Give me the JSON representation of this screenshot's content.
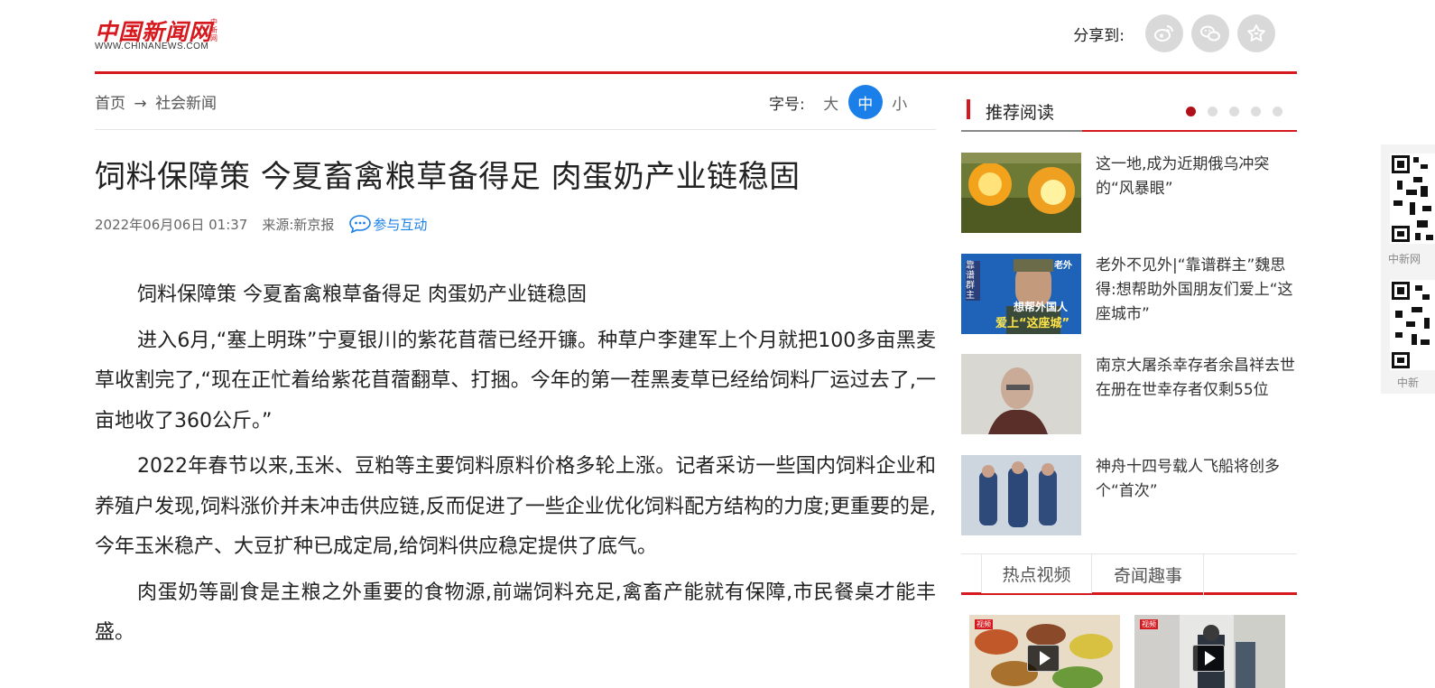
{
  "header": {
    "logo_cn": "中国新闻网",
    "logo_vert": "中新网",
    "logo_en": "WWW.CHINANEWS.COM",
    "share_label": "分享到:",
    "share_icons": [
      "weibo-icon",
      "wechat-icon",
      "favorite-icon"
    ]
  },
  "breadcrumb": {
    "home": "首页",
    "arrow": "→",
    "section": "社会新闻"
  },
  "font_size": {
    "label": "字号:",
    "options": [
      "大",
      "中",
      "小"
    ],
    "selected": "中"
  },
  "article": {
    "title": "饲料保障策 今夏畜禽粮草备得足 肉蛋奶产业链稳固",
    "date": "2022年06月06日 01:37",
    "source": "来源:新京报",
    "interact": "参与互动",
    "paragraphs": [
      "饲料保障策 今夏畜禽粮草备得足 肉蛋奶产业链稳固",
      "进入6月,“塞上明珠”宁夏银川的紫花苜蓿已经开镰。种草户李建军上个月就把100多亩黑麦草收割完了,“现在正忙着给紫花苜蓿翻草、打捆。今年的第一茬黑麦草已经给饲料厂运过去了,一亩地收了360公斤。”",
      "2022年春节以来,玉米、豆粕等主要饲料原料价格多轮上涨。记者采访一些国内饲料企业和养殖户发现,饲料涨价并未冲击供应链,反而促进了一些企业优化饲料配方结构的力度;更重要的是,今年玉米稳产、大豆扩种已成定局,给饲料供应稳定提供了底气。",
      "肉蛋奶等副食是主粮之外重要的食物源,前端饲料充足,禽畜产能就有保障,市民餐桌才能丰盛。"
    ]
  },
  "sidebar": {
    "recommend_title": "推荐阅读",
    "carousel_pages": 5,
    "carousel_active": 1,
    "items": [
      {
        "text": "这一地,成为近期俄乌冲突的“风暴眼”"
      },
      {
        "text": "老外不见外|“靠谱群主”魏思得:想帮助外国朋友们爱上“这座城市”",
        "thumb_caption_1": "靠谱群主",
        "thumb_caption_2": "想帮外国人",
        "thumb_caption_3": "爱上“这座城”",
        "thumb_badge": "老外"
      },
      {
        "text": "南京大屠杀幸存者余昌祥去世 在册在世幸存者仅剩55位"
      },
      {
        "text": "神舟十四号载人飞船将创多个“首次”"
      }
    ],
    "tabs": [
      "热点视频",
      "奇闻趣事"
    ],
    "active_tab": "热点视频",
    "video_badge": "视频"
  },
  "qr_panel": {
    "captions": [
      "中新网",
      "中新"
    ]
  },
  "colors": {
    "brand_red": "#d6191f",
    "accent_blue": "#1a7fe8"
  }
}
